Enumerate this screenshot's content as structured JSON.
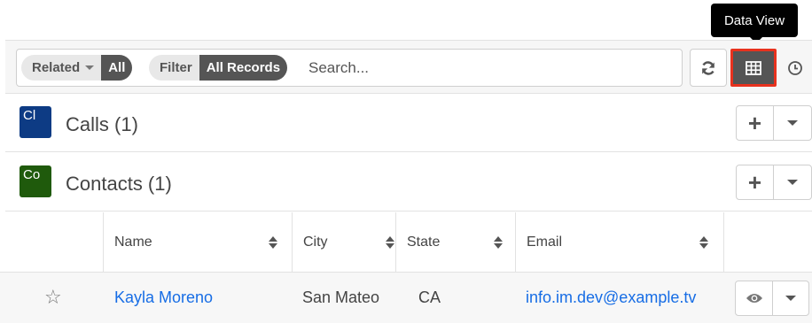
{
  "tooltip": {
    "text": "Data View"
  },
  "filter": {
    "related_label": "Related",
    "related_value": "All",
    "filter_label": "Filter",
    "filter_value": "All Records",
    "search_placeholder": "Search..."
  },
  "toolbar": {
    "icons": [
      "refresh-icon",
      "grid-icon",
      "clock-icon"
    ],
    "highlight_color": "#e8321e"
  },
  "subpanels": [
    {
      "icon_text": "Cl",
      "icon_color": "#0d3b84",
      "title": "Calls (1)"
    },
    {
      "icon_text": "Co",
      "icon_color": "#1f5a0c",
      "title": "Contacts (1)"
    }
  ],
  "table": {
    "columns": [
      "Name",
      "City",
      "State",
      "Email"
    ],
    "rows": [
      {
        "name": "Kayla Moreno",
        "city": "San Mateo",
        "state": "CA",
        "email": "info.im.dev@example.tv"
      }
    ]
  }
}
